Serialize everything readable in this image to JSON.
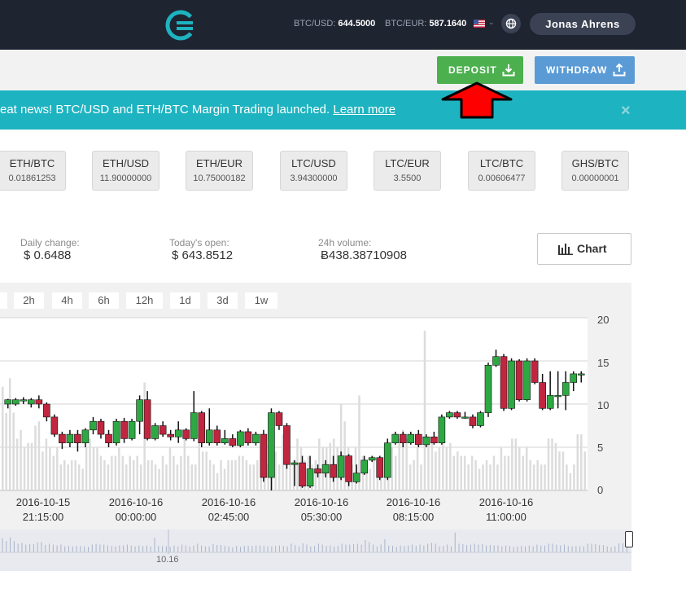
{
  "header": {
    "ticker_usd_label": "BTC/USD:",
    "ticker_usd_value": "644.5000",
    "ticker_eur_label": "BTC/EUR:",
    "ticker_eur_value": "587.1640",
    "user_name": "Jonas Ahrens"
  },
  "actions": {
    "deposit_label": "DEPOSIT",
    "withdraw_label": "WITHDRAW"
  },
  "banner": {
    "text": "eat news! BTC/USD and ETH/BTC Margin Trading launched.",
    "link": "Learn more",
    "close": "×"
  },
  "pairs": [
    {
      "name": "ETH/BTC",
      "value": "0.01861253"
    },
    {
      "name": "ETH/USD",
      "value": "11.90000000"
    },
    {
      "name": "ETH/EUR",
      "value": "10.75000182"
    },
    {
      "name": "LTC/USD",
      "value": "3.94300000"
    },
    {
      "name": "LTC/EUR",
      "value": "3.5500"
    },
    {
      "name": "LTC/BTC",
      "value": "0.00606477"
    },
    {
      "name": "GHS/BTC",
      "value": "0.00000001"
    }
  ],
  "stats": {
    "daily_change_label": "Daily change:",
    "daily_change_value": "$ 0.6488",
    "todays_open_label": "Today's open:",
    "todays_open_value": "$ 643.8512",
    "volume_label": "24h volume:",
    "volume_value": "Ƀ438.38710908",
    "chart_button_label": "Chart"
  },
  "periods": [
    "2h",
    "4h",
    "6h",
    "12h",
    "1d",
    "3d",
    "1w"
  ],
  "navigator_label": "10.16",
  "icons": {
    "logo": "cex-logo-icon",
    "flag": "us-flag-icon",
    "globe": "globe-icon",
    "deposit": "download-icon",
    "withdraw": "upload-icon",
    "chart": "bar-chart-icon",
    "annotation": "red-arrow-icon"
  },
  "colors": {
    "topbar": "#1f2431",
    "deposit": "#4cb04e",
    "withdraw": "#5b9bd5",
    "banner": "#1eb3c0",
    "candle_up": "#2ea843",
    "candle_down": "#c0263f",
    "volume": "#dcdcdc",
    "annotation_arrow": "#ff0000"
  },
  "chart_data": {
    "type": "candlestick",
    "y_ticks": [
      "20",
      "15",
      "10",
      "5",
      "0"
    ],
    "ylim": [
      0,
      20
    ],
    "x_labels": [
      {
        "date": "2016-10-15",
        "time": "21:15:00"
      },
      {
        "date": "2016-10-16",
        "time": "00:00:00"
      },
      {
        "date": "2016-10-16",
        "time": "02:45:00"
      },
      {
        "date": "2016-10-16",
        "time": "05:30:00"
      },
      {
        "date": "2016-10-16",
        "time": "08:15:00"
      },
      {
        "date": "2016-10-16",
        "time": "11:00:00"
      }
    ],
    "candles": [
      [
        10,
        10.5,
        9.5,
        10.6
      ],
      [
        10,
        10.5,
        9.8,
        10.7
      ],
      [
        10.5,
        10.5,
        10,
        10.8
      ],
      [
        10,
        10.5,
        9.6,
        10.7
      ],
      [
        10.5,
        10,
        9.5,
        11
      ],
      [
        10,
        8.5,
        8,
        10.2
      ],
      [
        8.5,
        6.5,
        6.2,
        8.8
      ],
      [
        6.5,
        5.5,
        4.8,
        6.8
      ],
      [
        5.5,
        6.5,
        5,
        7
      ],
      [
        6.5,
        5.5,
        4.5,
        7
      ],
      [
        5.5,
        7,
        5,
        7.2
      ],
      [
        7,
        8,
        6.5,
        8.5
      ],
      [
        8,
        6.5,
        6,
        8.3
      ],
      [
        6.5,
        5.5,
        5,
        7
      ],
      [
        5.5,
        8,
        5.2,
        8.3
      ],
      [
        8,
        6,
        5.5,
        8.4
      ],
      [
        6,
        8,
        5.8,
        8.3
      ],
      [
        8,
        10.5,
        6.5,
        11
      ],
      [
        10.5,
        6,
        5.8,
        11.5
      ],
      [
        6,
        7.5,
        5.8,
        7.8
      ],
      [
        7.5,
        6.5,
        6.2,
        8
      ],
      [
        6.5,
        6.2,
        5.8,
        7
      ],
      [
        6.2,
        7,
        5.5,
        8
      ],
      [
        7,
        6,
        5.8,
        7.2
      ],
      [
        6,
        9,
        5.7,
        11.5
      ],
      [
        9,
        5.5,
        5,
        9.2
      ],
      [
        5.5,
        7,
        5.2,
        9.5
      ],
      [
        7,
        5.5,
        5.2,
        7.5
      ],
      [
        5.5,
        6,
        5.3,
        7
      ],
      [
        6,
        5.2,
        5,
        6.5
      ],
      [
        5.2,
        6.8,
        5,
        7
      ],
      [
        6.8,
        5.5,
        5.2,
        7.2
      ],
      [
        5.5,
        6.5,
        5.2,
        6.8
      ],
      [
        6.5,
        1.5,
        1,
        7
      ],
      [
        1.5,
        9,
        0,
        9.5
      ],
      [
        9,
        7.5,
        7,
        9.2
      ],
      [
        7.5,
        3,
        2.5,
        7.8
      ],
      [
        3,
        3.2,
        0.5,
        3.5
      ],
      [
        3.2,
        0.5,
        0.3,
        4
      ],
      [
        0.5,
        2.5,
        0.3,
        4
      ],
      [
        2.5,
        2,
        1.5,
        3
      ],
      [
        2,
        3,
        1.5,
        3.5
      ],
      [
        3,
        1.5,
        1,
        4
      ],
      [
        1.5,
        4,
        1.2,
        4.5
      ],
      [
        4,
        1,
        0.5,
        4.2
      ],
      [
        1,
        2,
        0.8,
        3
      ],
      [
        2,
        3.5,
        1.8,
        4
      ],
      [
        3.5,
        3.8,
        3.3,
        4
      ],
      [
        3.8,
        1.5,
        1.2,
        4
      ],
      [
        1.5,
        5.5,
        1.2,
        6
      ],
      [
        5.5,
        6.5,
        5.3,
        6.8
      ],
      [
        6.5,
        5.5,
        5,
        6.8
      ],
      [
        5.5,
        6.5,
        5.3,
        6.8
      ],
      [
        6.5,
        5.3,
        5,
        7
      ],
      [
        5.3,
        6.2,
        5,
        6.5
      ],
      [
        6.2,
        5.5,
        5.3,
        6.8
      ],
      [
        5.5,
        8.5,
        5.3,
        8.8
      ],
      [
        8.5,
        9,
        8.3,
        9.2
      ],
      [
        9,
        8.5,
        8.3,
        9.2
      ],
      [
        8.5,
        8.5,
        8.3,
        9.1
      ],
      [
        8.5,
        7.5,
        7.2,
        8.8
      ],
      [
        7.5,
        9,
        7.3,
        9.2
      ],
      [
        9,
        14.5,
        8.5,
        14.8
      ],
      [
        14.5,
        15.5,
        14.3,
        16.3
      ],
      [
        15.5,
        9.5,
        9.2,
        15.8
      ],
      [
        9.5,
        15,
        9.3,
        15.3
      ],
      [
        15,
        10.5,
        10.3,
        15.2
      ],
      [
        10.5,
        15,
        10.3,
        15.3
      ],
      [
        15,
        12.5,
        12.3,
        15.3
      ],
      [
        12.5,
        9.5,
        9.3,
        13.5
      ],
      [
        9.5,
        11,
        9.3,
        13.8
      ],
      [
        11,
        11,
        9.5,
        13.8
      ],
      [
        11,
        12.5,
        9.3,
        13.8
      ],
      [
        12.5,
        13.5,
        11.5,
        13.8
      ],
      [
        13.5,
        13.5,
        12.5,
        13.8
      ]
    ],
    "volume": [
      12,
      9,
      13,
      9,
      6,
      7,
      5,
      5.5,
      5.5,
      7.5,
      8,
      4.5,
      6,
      5,
      4,
      5,
      3,
      3.5,
      3,
      3.5,
      3.5,
      3,
      2.5,
      5,
      6,
      5,
      5,
      4,
      3.5,
      3,
      4,
      4,
      5,
      4,
      3,
      4,
      3.5,
      4,
      3,
      12.5,
      3.5,
      3.5,
      3,
      2.5,
      4,
      3,
      5,
      4,
      3,
      4,
      6,
      4,
      3,
      3,
      5.5,
      4.5,
      4.5,
      3.5,
      3,
      2,
      3.5,
      2.5,
      3.5,
      3.5,
      3.5,
      4,
      4,
      3.5,
      3,
      3,
      3.5,
      4,
      3.5,
      3,
      6,
      4.5,
      3,
      6.5,
      5,
      3,
      3.5,
      6,
      5,
      3.5,
      4,
      3,
      3.5,
      6,
      5,
      5,
      5.5,
      6,
      5,
      10,
      8,
      5,
      3,
      5,
      11,
      4,
      3.5,
      2.5,
      4,
      3.5,
      4,
      5,
      3.5,
      5,
      4,
      6,
      7,
      6,
      3,
      3.5,
      5,
      3,
      18.5,
      6,
      5.5,
      4.5,
      5,
      6,
      5,
      5.5,
      4,
      4.5,
      4,
      4,
      3,
      4,
      3.5,
      2.5,
      3,
      3.5,
      3,
      4,
      3,
      5,
      4,
      4,
      6,
      6,
      5,
      4,
      5,
      3.5,
      3,
      3.5,
      3,
      3,
      6,
      6,
      5.5,
      4.5,
      4.5,
      3,
      2,
      3,
      6.5,
      6.5,
      4.5
    ]
  }
}
